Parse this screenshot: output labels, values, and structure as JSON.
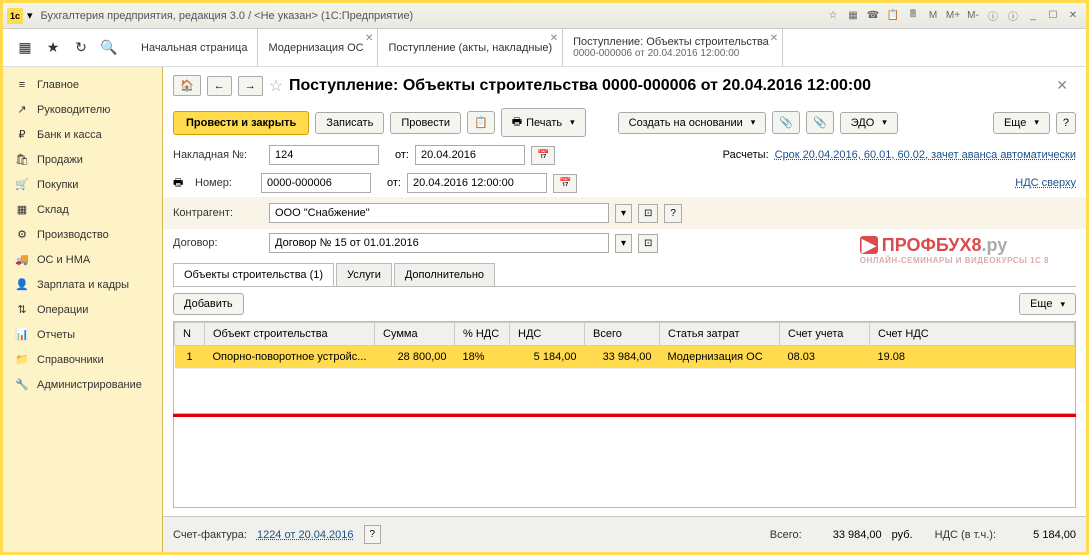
{
  "window_title": "Бухгалтерия предприятия, редакция 3.0 / <Не указан> (1С:Предприятие)",
  "topbar_btns": [
    "M",
    "M+",
    "M-",
    "ⓘ",
    "ⓘ",
    "_",
    "☐",
    "✕"
  ],
  "tabs": [
    {
      "label": "Начальная страница"
    },
    {
      "label": "Модернизация ОС"
    },
    {
      "label": "Поступление (акты, накладные)"
    },
    {
      "label": "Поступление: Объекты строительства",
      "sub": "0000-000006 от 20.04.2016 12:00:00"
    }
  ],
  "sidebar": [
    {
      "icon": "≡",
      "label": "Главное"
    },
    {
      "icon": "↗",
      "label": "Руководителю"
    },
    {
      "icon": "₽",
      "label": "Банк и касса"
    },
    {
      "icon": "🛍",
      "label": "Продажи"
    },
    {
      "icon": "🛒",
      "label": "Покупки"
    },
    {
      "icon": "▦",
      "label": "Склад"
    },
    {
      "icon": "⚙",
      "label": "Производство"
    },
    {
      "icon": "🚚",
      "label": "ОС и НМА"
    },
    {
      "icon": "👤",
      "label": "Зарплата и кадры"
    },
    {
      "icon": "⇅",
      "label": "Операции"
    },
    {
      "icon": "📊",
      "label": "Отчеты"
    },
    {
      "icon": "📁",
      "label": "Справочники"
    },
    {
      "icon": "🔧",
      "label": "Администрирование"
    }
  ],
  "doc_title": "Поступление: Объекты строительства 0000-000006 от 20.04.2016 12:00:00",
  "toolbar": {
    "primary": "Провести и закрыть",
    "write": "Записать",
    "post": "Провести",
    "print": "Печать",
    "create_based": "Создать на основании",
    "edo": "ЭДО",
    "more": "Еще"
  },
  "form": {
    "invoice_label": "Накладная  №:",
    "invoice_no": "124",
    "from_label": "от:",
    "invoice_date": "20.04.2016",
    "number_label": "Номер:",
    "number": "0000-000006",
    "datetime": "20.04.2016 12:00:00",
    "calc_label": "Расчеты:",
    "calc_value": "Срок 20.04.2016, 60.01, 60.02, зачет аванса автоматически",
    "vat_link": "НДС сверху",
    "counterparty_label": "Контрагент:",
    "counterparty": "ООО \"Снабжение\"",
    "contract_label": "Договор:",
    "contract": "Договор № 15 от 01.01.2016"
  },
  "subtabs": [
    "Объекты строительства (1)",
    "Услуги",
    "Дополнительно"
  ],
  "add_btn": "Добавить",
  "grid_headers": [
    "N",
    "Объект строительства",
    "Сумма",
    "% НДС",
    "НДС",
    "Всего",
    "Статья затрат",
    "Счет учета",
    "Счет НДС"
  ],
  "grid_rows": [
    {
      "n": "1",
      "obj": "Опорно-поворотное устройс...",
      "sum": "28 800,00",
      "vat_pct": "18%",
      "vat": "5 184,00",
      "total": "33 984,00",
      "cost_item": "Модернизация ОС",
      "acct": "08.03",
      "vat_acct": "19.08"
    }
  ],
  "footer": {
    "sf_label": "Счет-фактура:",
    "sf_value": "1224 от 20.04.2016",
    "total_label": "Всего:",
    "total": "33 984,00",
    "currency": "руб.",
    "vat_label": "НДС (в т.ч.):",
    "vat": "5 184,00"
  },
  "watermark": {
    "brand": "ПРОФБУХ8",
    "suffix": ".ру",
    "sub": "ОНЛАЙН-СЕМИНАРЫ И ВИДЕОКУРСЫ 1С 8"
  }
}
